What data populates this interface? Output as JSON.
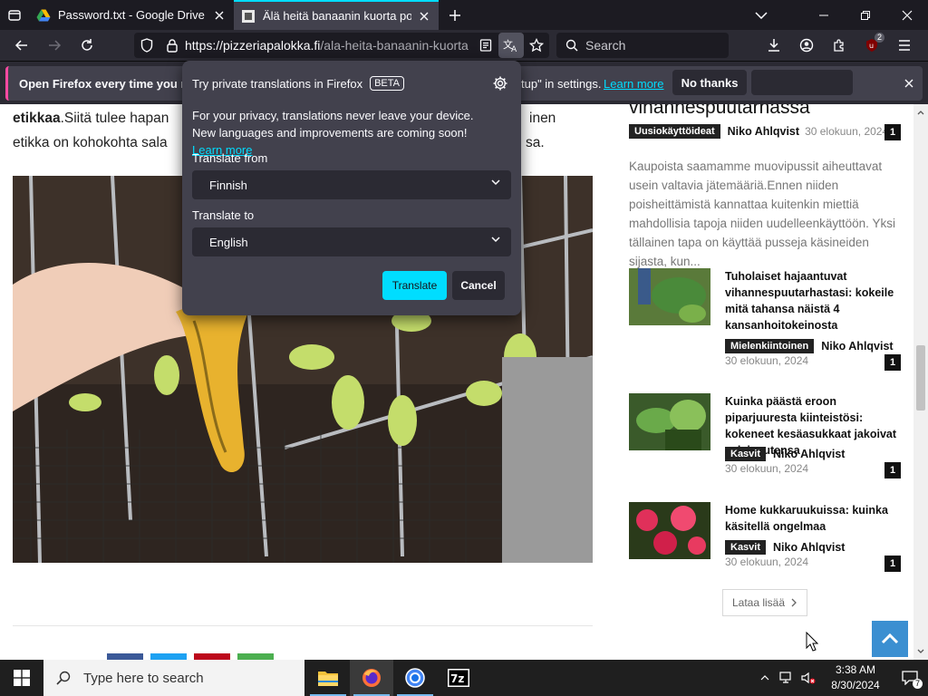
{
  "tabs": [
    {
      "title": "Password.txt - Google Drive",
      "active": false,
      "favicon": "google-drive-icon"
    },
    {
      "title": "Älä heitä banaanin kuorta pois",
      "active": true,
      "favicon": "site-favicon"
    }
  ],
  "navbar": {
    "url_host": "https://pizzeriapalokka.fi",
    "url_path": "/ala-heita-banaanin-kuorta",
    "search_placeholder": "Search",
    "extensions_badge": "2"
  },
  "notification": {
    "message": "Open Firefox every time you res",
    "message_tail": "tup\" in settings.",
    "learn_more": "Learn more",
    "no_thanks": "No thanks"
  },
  "translation_popup": {
    "title": "Try private translations in Firefox",
    "beta": "BETA",
    "privacy_text": "For your privacy, translations never leave your device. New languages and improvements are coming soon!",
    "learn_more": "Learn more",
    "from_label": "Translate from",
    "from_value": "Finnish",
    "to_label": "Translate to",
    "to_value": "English",
    "translate_button": "Translate",
    "cancel_button": "Cancel"
  },
  "article": {
    "bold_lead": "etikkaa",
    "line1_rest": ".Siitä tulee hapan",
    "line1_tail": "inen",
    "line2": "etikka on kohokohta sala",
    "line2_tail": "sa."
  },
  "sidebar": {
    "heading": "vihannespuutarhassa",
    "top_meta": {
      "category": "Uusiokäyttöideat",
      "author": "Niko Ahlqvist",
      "date": "30 elokuun, 2024",
      "count": "1"
    },
    "excerpt": "Kaupoista saamamme muovipussit aiheuttavat usein valtavia jätemääriä.Ennen niiden poisheittämistä kannattaa kuitenkin miettiä mahdollisia tapoja niiden uudelleenkäyttöön. Yksi tällainen tapa on käyttää pusseja käsineiden sijasta, kun...",
    "items": [
      {
        "title": "Tuholaiset hajaantuvat vihannespuutarhastasi: kokeile mitä tahansa näistä 4 kansanhoitokeinosta",
        "category": "Mielenkiintoinen",
        "author": "Niko Ahlqvist",
        "date": "30 elokuun, 2024",
        "count": "1"
      },
      {
        "title": "Kuinka päästä eroon piparjuuresta kiinteistösi: kokeneet kesäasukkaat jakoivat salaisuutensa",
        "category": "Kasvit",
        "author": "Niko Ahlqvist",
        "date": "30 elokuun, 2024",
        "count": "1"
      },
      {
        "title": "Home kukkaruukuissa: kuinka käsitellä ongelmaa",
        "category": "Kasvit",
        "author": "Niko Ahlqvist",
        "date": "30 elokuun, 2024",
        "count": "1"
      }
    ],
    "load_more": "Lataa lisää"
  },
  "taskbar": {
    "search_placeholder": "Type here to search",
    "time": "3:38 AM",
    "date": "8/30/2024",
    "notification_count": "7"
  }
}
